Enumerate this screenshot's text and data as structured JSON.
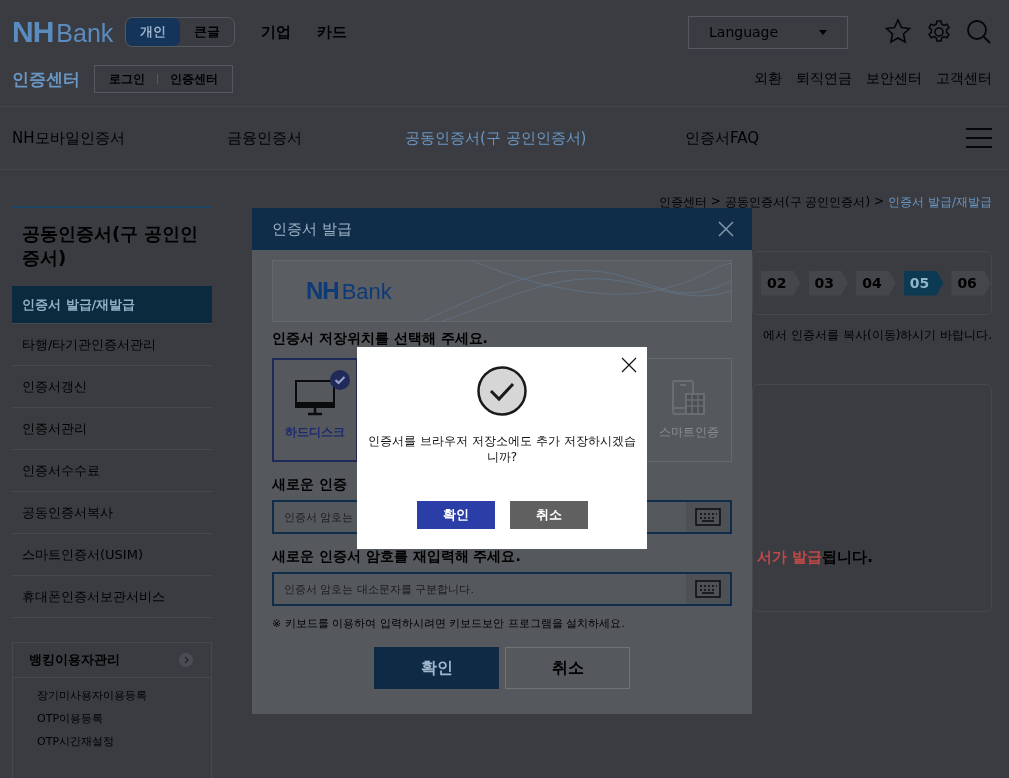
{
  "header": {
    "logo": {
      "mark": "NH",
      "word": "Bank"
    },
    "view_tabs": [
      {
        "label": "개인",
        "selected": true
      },
      {
        "label": "큰글",
        "selected": false
      }
    ],
    "menu": [
      "기업",
      "카드"
    ],
    "language": "Language",
    "center_title": "인증센터",
    "center_links": [
      "로그인",
      "인증센터"
    ],
    "utility_links": [
      "외환",
      "퇴직연금",
      "보안센터",
      "고객센터"
    ]
  },
  "nav": [
    {
      "label": "NH모바일인증서",
      "selected": false
    },
    {
      "label": "금융인증서",
      "selected": false
    },
    {
      "label": "공동인증서(구 공인인증서)",
      "selected": true
    },
    {
      "label": "인증서FAQ",
      "selected": false
    }
  ],
  "sidebar": {
    "title": "공동인증서(구 공인인증서)",
    "items": [
      {
        "label": "인증서 발급/재발급",
        "selected": true
      },
      {
        "label": "타행/타기관인증서관리",
        "selected": false
      },
      {
        "label": "인증서갱신",
        "selected": false
      },
      {
        "label": "인증서관리",
        "selected": false
      },
      {
        "label": "인증서수수료",
        "selected": false
      },
      {
        "label": "공동인증서복사",
        "selected": false
      },
      {
        "label": "스마트인증서(USIM)",
        "selected": false
      },
      {
        "label": "휴대폰인증서보관서비스",
        "selected": false
      }
    ],
    "panel": {
      "title": "뱅킹이용자관리",
      "links": [
        "장기미사용자이용등록",
        "OTP이용등록",
        "OTP시간재설정"
      ]
    }
  },
  "breadcrumb": [
    {
      "label": "인증센터",
      "current": false
    },
    {
      "separator": ">",
      "label": "공동인증서(구 공인인증서)",
      "current": false
    },
    {
      "separator": ">",
      "label": "인증서 발급/재발급",
      "current": true
    }
  ],
  "steps": [
    {
      "label": "02",
      "selected": false
    },
    {
      "label": "03",
      "selected": false
    },
    {
      "label": "04",
      "selected": false
    },
    {
      "label": "05",
      "selected": true
    },
    {
      "label": "06",
      "selected": false
    }
  ],
  "notice": "에서 인증서를 복사(이동)하시기 바랍니다.",
  "result": {
    "highlight": "서가 발급",
    "rest": "됩니다."
  },
  "modal": {
    "title": "인증서 발급",
    "banner_logo": {
      "mark": "NH",
      "word": "Bank"
    },
    "storage_label": "인증서 저장위치를 선택해 주세요.",
    "storage_options": [
      {
        "label": "하드디스크",
        "kind": "disk",
        "selected": true
      },
      {
        "label": "스마트인증",
        "kind": "phone",
        "selected": false
      }
    ],
    "fields": [
      {
        "label": "새로운 인증",
        "placeholder": "인증서 암호는"
      },
      {
        "label": "새로운 인증서 암호를 재입력해 주세요.",
        "placeholder": "인증서 암호는 대소문자를 구분합니다."
      }
    ],
    "note": "※ 키보드를 이용하여 입력하시려면 키보드보안 프로그램을 설치하세요.",
    "buttons": [
      {
        "label": "확인",
        "kind": "primary"
      },
      {
        "label": "취소",
        "kind": "secondary"
      }
    ]
  },
  "alert": {
    "message": "인증서를 브라우저 저장소에도 추가 저장하시겠습니까?",
    "buttons": [
      {
        "label": "확인",
        "kind": "primary"
      },
      {
        "label": "취소",
        "kind": "secondary"
      }
    ]
  }
}
